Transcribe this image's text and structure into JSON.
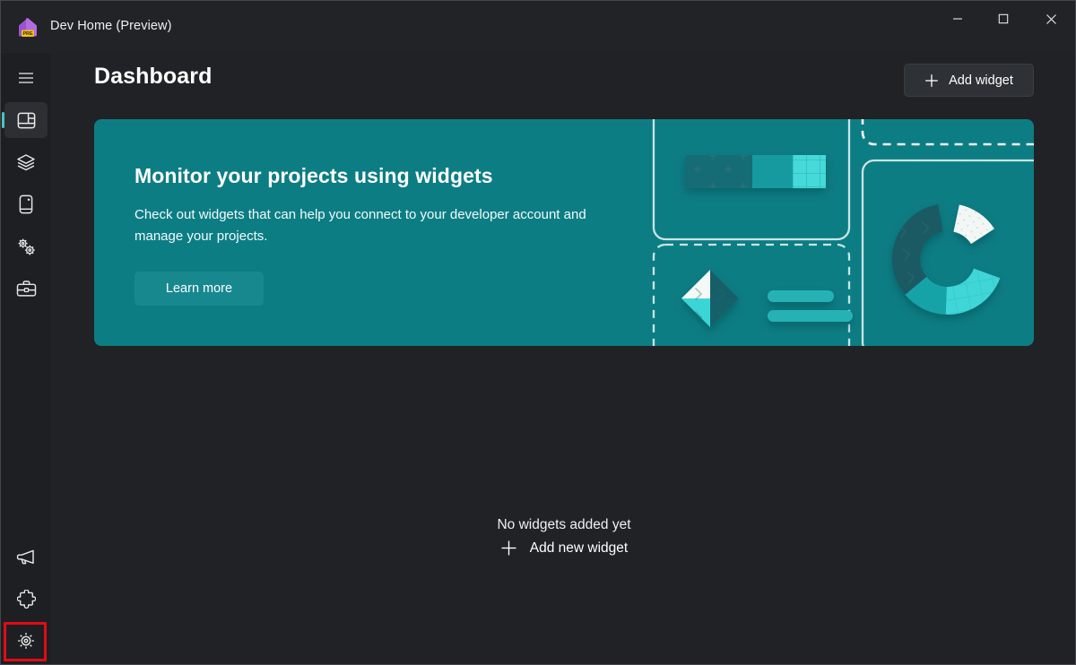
{
  "window": {
    "title": "Dev Home (Preview)",
    "app_icon": "home-icon",
    "badge_text": "PRE",
    "controls": [
      {
        "name": "minimize-button",
        "icon": "minimize-icon",
        "label": "Minimize"
      },
      {
        "name": "maximize-button",
        "icon": "maximize-icon",
        "label": "Maximize"
      },
      {
        "name": "close-button",
        "icon": "close-icon",
        "label": "Close"
      }
    ]
  },
  "sidebar": {
    "top_items": [
      {
        "name": "nav-hamburger",
        "icon": "hamburger-menu-icon",
        "label": "Navigation menu",
        "selected": false
      },
      {
        "name": "nav-dashboard",
        "icon": "dashboard-icon",
        "label": "Dashboard",
        "selected": true
      },
      {
        "name": "nav-layers",
        "icon": "layers-icon",
        "label": "Environments",
        "selected": false
      },
      {
        "name": "nav-device",
        "icon": "device-icon",
        "label": "Utilities",
        "selected": false
      },
      {
        "name": "nav-config",
        "icon": "gears-icon",
        "label": "Machine configuration",
        "selected": false
      },
      {
        "name": "nav-toolbox",
        "icon": "toolbox-icon",
        "label": "Dev tools",
        "selected": false
      }
    ],
    "bottom_items": [
      {
        "name": "nav-feedback",
        "icon": "megaphone-icon",
        "label": "Feedback",
        "selected": false
      },
      {
        "name": "nav-extensions",
        "icon": "puzzle-piece-icon",
        "label": "Extensions",
        "selected": false
      },
      {
        "name": "nav-settings",
        "icon": "gear-icon",
        "label": "Settings",
        "selected": false
      }
    ],
    "highlight": {
      "target": "nav-settings",
      "color": "#e00b15"
    },
    "accent_color": "#4cc2c4"
  },
  "main": {
    "page_title": "Dashboard",
    "add_widget": {
      "label": "Add widget",
      "icon": "plus-icon"
    },
    "banner": {
      "heading": "Monitor your projects using widgets",
      "body": "Check out widgets that can help you connect to your developer account and manage your projects.",
      "learn_more_label": "Learn more",
      "close_icon": "close-icon",
      "background_color": "#0d7d84",
      "button_color": "#18888f"
    },
    "empty_state": {
      "title": "No widgets added yet",
      "add_link_label": "Add new widget",
      "add_link_icon": "plus-icon"
    }
  }
}
